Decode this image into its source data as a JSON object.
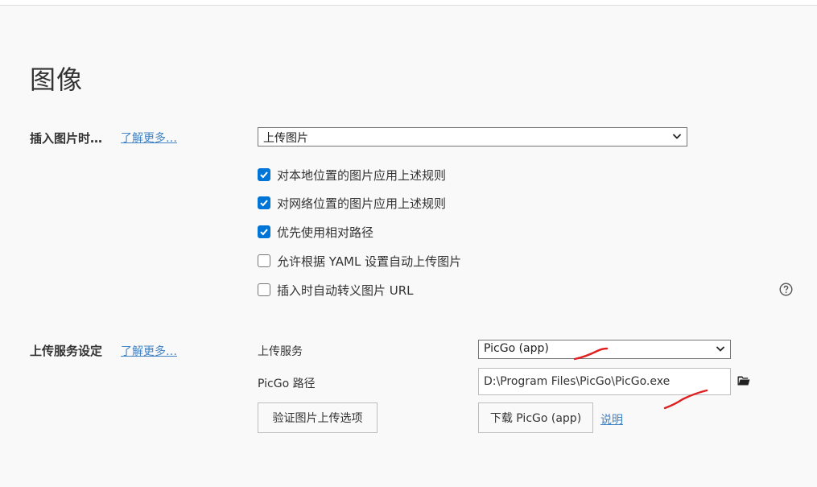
{
  "page": {
    "title": "图像"
  },
  "insert_image": {
    "label": "插入图片时…",
    "learn_more": "了解更多…",
    "select_value": "上传图片",
    "options": [
      {
        "label": "对本地位置的图片应用上述规则",
        "checked": true
      },
      {
        "label": "对网络位置的图片应用上述规则",
        "checked": true
      },
      {
        "label": "优先使用相对路径",
        "checked": true
      },
      {
        "label": "允许根据 YAML 设置自动上传图片",
        "checked": false
      },
      {
        "label": "插入时自动转义图片 URL",
        "checked": false
      }
    ]
  },
  "upload_service": {
    "label": "上传服务设定",
    "learn_more": "了解更多…",
    "service_label": "上传服务",
    "service_value": "PicGo (app)",
    "path_label": "PicGo 路径",
    "path_value": "D:\\Program Files\\PicGo\\PicGo.exe",
    "verify_button": "验证图片上传选项",
    "download_button": "下载 PicGo (app)",
    "help_link": "说明"
  },
  "colors": {
    "accent": "#0075d8",
    "link": "#4183c4",
    "annotation": "#e02020"
  },
  "icons": [
    "chevron-down-icon",
    "checkmark-icon",
    "help-icon",
    "folder-icon"
  ]
}
